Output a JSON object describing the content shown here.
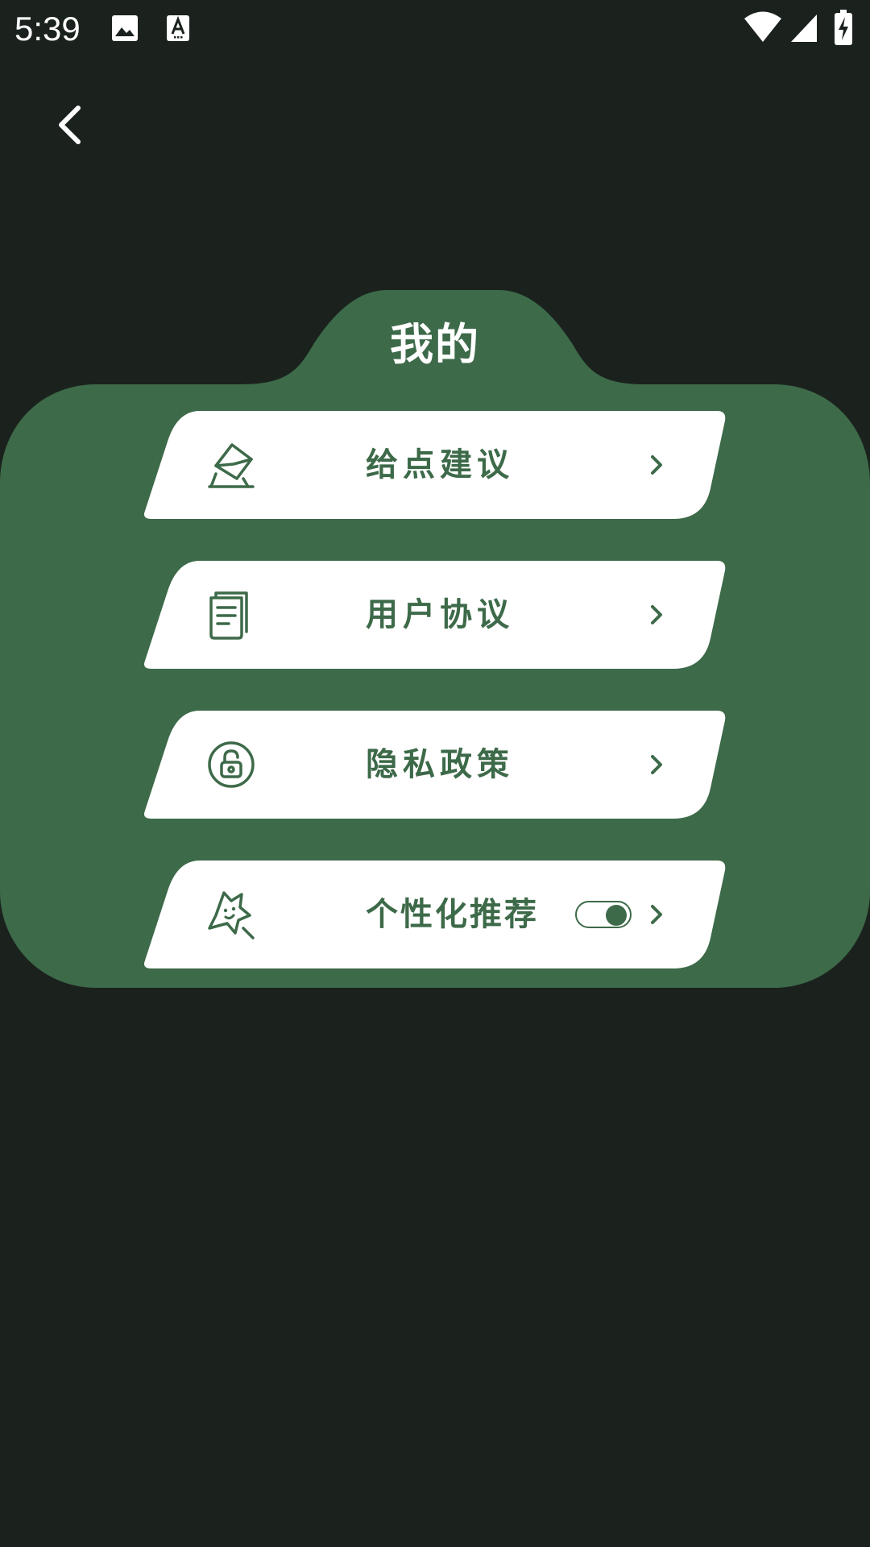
{
  "status_bar": {
    "time": "5:39",
    "icons": [
      "gallery-icon",
      "font-icon",
      "wifi-icon",
      "signal-icon",
      "battery-charging-icon"
    ]
  },
  "nav": {
    "back_icon": "chevron-left-icon"
  },
  "card": {
    "title": "我的",
    "items": [
      {
        "label": "给点建议",
        "icon": "feedback-envelope-icon",
        "trailing": "chevron-right-icon"
      },
      {
        "label": "用户协议",
        "icon": "document-icon",
        "trailing": "chevron-right-icon"
      },
      {
        "label": "隐私政策",
        "icon": "unlock-icon",
        "trailing": "chevron-right-icon"
      },
      {
        "label": "个性化推荐",
        "icon": "star-icon",
        "trailing": "chevron-right-icon",
        "toggle": {
          "on": true
        }
      }
    ]
  },
  "colors": {
    "background": "#1b221e",
    "card": "#3d6a49",
    "item_bg": "#ffffff",
    "accent": "#3d6a49",
    "text_light": "#ffffff"
  }
}
